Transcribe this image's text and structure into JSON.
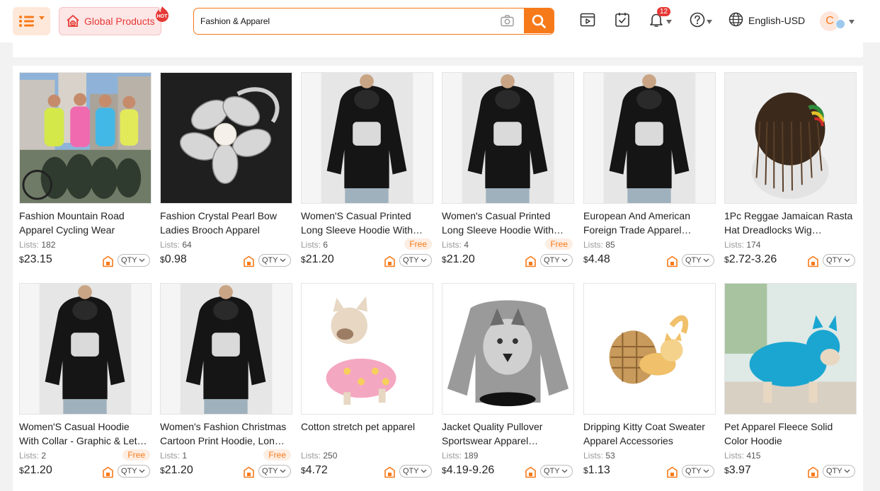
{
  "header": {
    "global_label": "Global Products",
    "hot_label": "HOT",
    "search_value": "Fashion & Apparel",
    "notification_count": "12",
    "language": "English-USD",
    "avatar_initial": "C"
  },
  "colors": {
    "accent": "#f77a1a",
    "hot": "#e53935"
  },
  "products": [
    {
      "title": "Fashion Mountain Road Apparel Cycling Wear",
      "lists_label": "Lists:",
      "lists": "182",
      "currency": "$",
      "price": "23.15",
      "free": "",
      "qty": "QTY",
      "image": "cyclists-photo"
    },
    {
      "title": "Fashion Crystal Pearl Bow Ladies Brooch Apparel",
      "lists_label": "Lists:",
      "lists": "64",
      "currency": "$",
      "price": "0.98",
      "free": "",
      "qty": "QTY",
      "image": "brooch-photo"
    },
    {
      "title": "Women'S Casual Printed Long Sleeve Hoodie With…",
      "lists_label": "Lists:",
      "lists": "6",
      "currency": "$",
      "price": "21.20",
      "free": "Free",
      "qty": "QTY",
      "image": "hoodie-photo"
    },
    {
      "title": "Women's Casual Printed Long Sleeve Hoodie With…",
      "lists_label": "Lists:",
      "lists": "4",
      "currency": "$",
      "price": "21.20",
      "free": "Free",
      "qty": "QTY",
      "image": "hoodie-photo"
    },
    {
      "title": "European And American Foreign Trade Apparel…",
      "lists_label": "Lists:",
      "lists": "85",
      "currency": "$",
      "price": "4.48",
      "free": "",
      "qty": "QTY",
      "image": "hoodie-photo"
    },
    {
      "title": "1Pc Reggae Jamaican Rasta Hat Dreadlocks Wig…",
      "lists_label": "Lists:",
      "lists": "174",
      "currency": "$",
      "price": "2.72-3.26",
      "free": "",
      "qty": "QTY",
      "image": "wig-photo"
    },
    {
      "title": "Women'S Casual Hoodie With Collar - Graphic & Let…",
      "lists_label": "Lists:",
      "lists": "2",
      "currency": "$",
      "price": "21.20",
      "free": "Free",
      "qty": "QTY",
      "image": "hoodie-photo"
    },
    {
      "title": "Women's Fashion Christmas Cartoon Print Hoodie, Lon…",
      "lists_label": "Lists:",
      "lists": "1",
      "currency": "$",
      "price": "21.20",
      "free": "Free",
      "qty": "QTY",
      "image": "hoodie-photo"
    },
    {
      "title": "Cotton stretch pet apparel",
      "lists_label": "Lists:",
      "lists": "250",
      "currency": "$",
      "price": "4.72",
      "free": "",
      "qty": "QTY",
      "image": "pet-photo"
    },
    {
      "title": "Jacket Quality Pullover Sportswear Apparel…",
      "lists_label": "Lists:",
      "lists": "189",
      "currency": "$",
      "price": "4.19-9.26",
      "free": "",
      "qty": "QTY",
      "image": "wolf-sweater-photo"
    },
    {
      "title": "Dripping Kitty Coat Sweater Apparel Accessories",
      "lists_label": "Lists:",
      "lists": "53",
      "currency": "$",
      "price": "1.13",
      "free": "",
      "qty": "QTY",
      "image": "cat-ornament-photo"
    },
    {
      "title": "Pet Apparel Fleece Solid Color Hoodie",
      "lists_label": "Lists:",
      "lists": "415",
      "currency": "$",
      "price": "3.97",
      "free": "",
      "qty": "QTY",
      "image": "dog-hoodie-photo"
    }
  ]
}
